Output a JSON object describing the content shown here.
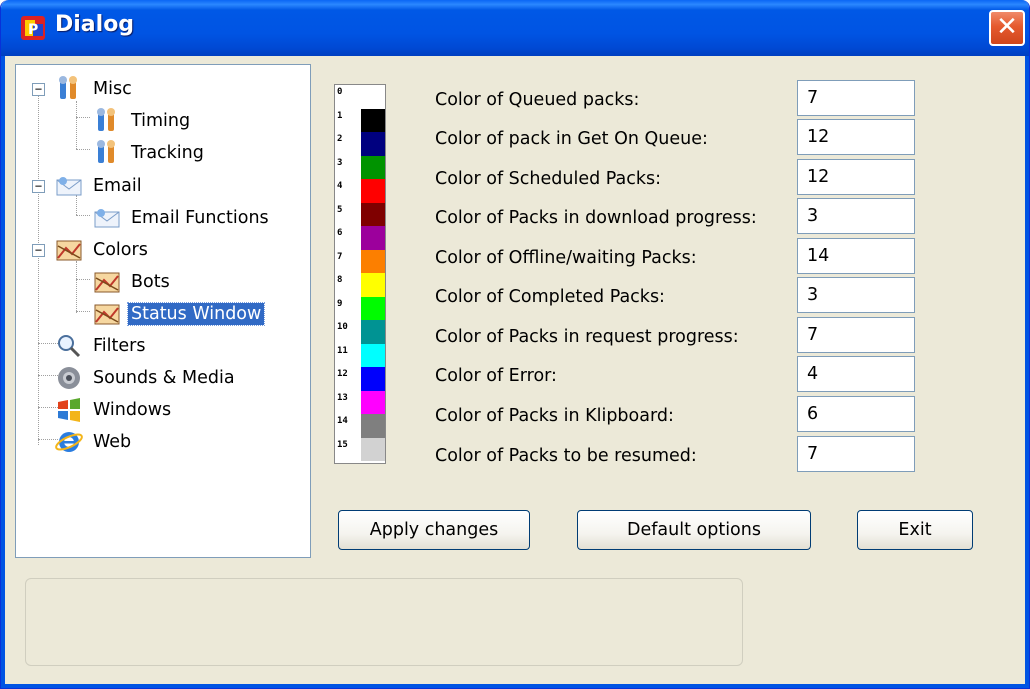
{
  "window": {
    "title": "Dialog"
  },
  "tree": {
    "items": [
      {
        "label": "Misc",
        "icon": "tools-icon"
      },
      {
        "label": "Timing",
        "icon": "tools-icon"
      },
      {
        "label": "Tracking",
        "icon": "tools-icon"
      },
      {
        "label": "Email",
        "icon": "envelope-icon"
      },
      {
        "label": "Email Functions",
        "icon": "envelope-icon"
      },
      {
        "label": "Colors",
        "icon": "palette-picture-icon"
      },
      {
        "label": "Bots",
        "icon": "palette-picture-icon"
      },
      {
        "label": "Status Window",
        "icon": "palette-picture-icon",
        "selected": true
      },
      {
        "label": "Filters",
        "icon": "magnifier-icon"
      },
      {
        "label": "Sounds & Media",
        "icon": "speaker-icon"
      },
      {
        "label": "Windows",
        "icon": "windows-flag-icon"
      },
      {
        "label": "Web",
        "icon": "internet-explorer-icon"
      }
    ]
  },
  "palette": {
    "numbers": [
      "0",
      "1",
      "2",
      "3",
      "4",
      "5",
      "6",
      "7",
      "8",
      "9",
      "10",
      "11",
      "12",
      "13",
      "14",
      "15"
    ],
    "colors": [
      "#ffffff",
      "#000000",
      "#00007f",
      "#009300",
      "#ff0000",
      "#7f0000",
      "#9c009c",
      "#fc7f00",
      "#ffff00",
      "#00fc00",
      "#009393",
      "#00ffff",
      "#0000fc",
      "#ff00ff",
      "#7f7f7f",
      "#d2d2d2"
    ]
  },
  "options": [
    {
      "label": "Color of Queued packs:",
      "value": "7"
    },
    {
      "label": "Color of pack in Get On Queue:",
      "value": "12"
    },
    {
      "label": "Color of Scheduled Packs:",
      "value": "12"
    },
    {
      "label": "Color of Packs in download progress:",
      "value": "3"
    },
    {
      "label": "Color of Offline/waiting Packs:",
      "value": "14"
    },
    {
      "label": "Color of Completed Packs:",
      "value": "3"
    },
    {
      "label": "Color of Packs in request progress:",
      "value": "7"
    },
    {
      "label": "Color of Error:",
      "value": "4"
    },
    {
      "label": "Color of Packs in Klipboard:",
      "value": "6"
    },
    {
      "label": "Color of Packs to be resumed:",
      "value": "7"
    }
  ],
  "buttons": {
    "apply": "Apply changes",
    "defaults": "Default options",
    "exit": "Exit"
  },
  "close_glyph": "✕",
  "colors": {
    "titlebar": "#0054e3",
    "selection": "#316ac5",
    "window_bg": "#ece9d8"
  }
}
